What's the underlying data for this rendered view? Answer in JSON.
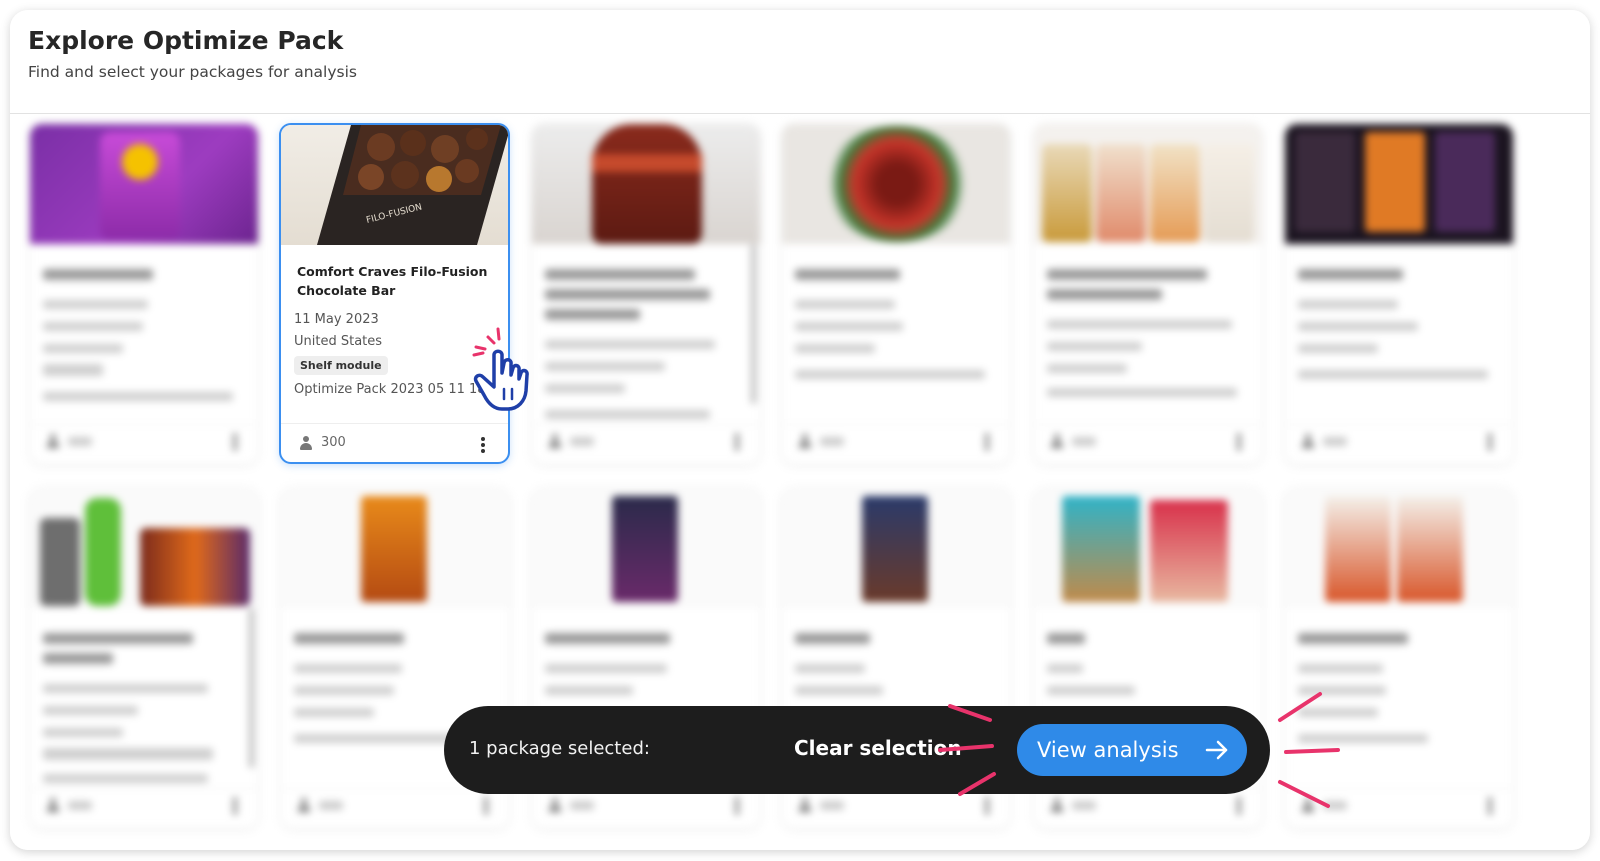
{
  "header": {
    "title": "Explore Optimize Pack",
    "subtitle": "Find and select your packages for analysis"
  },
  "selected_card": {
    "name": "Comfort Craves Filo-Fusion Chocolate Bar",
    "date": "11 May 2023",
    "country": "United States",
    "tag": "Shelf module",
    "pack": "Optimize Pack 2023 05 11 18:...",
    "respondents": "300",
    "thumb_text": "FILO-FUSION"
  },
  "action_bar": {
    "selection_text": "1 package selected:",
    "clear_label": "Clear selection",
    "view_label": "View analysis"
  },
  "colors": {
    "accent": "#2f8ae8",
    "selected_border": "#3b8ff0",
    "bar_bg": "#1d1d1d",
    "burst": "#e8336b"
  },
  "icons": [
    "person-icon",
    "kebab-icon",
    "arrow-right-icon",
    "hand-pointer-icon"
  ]
}
